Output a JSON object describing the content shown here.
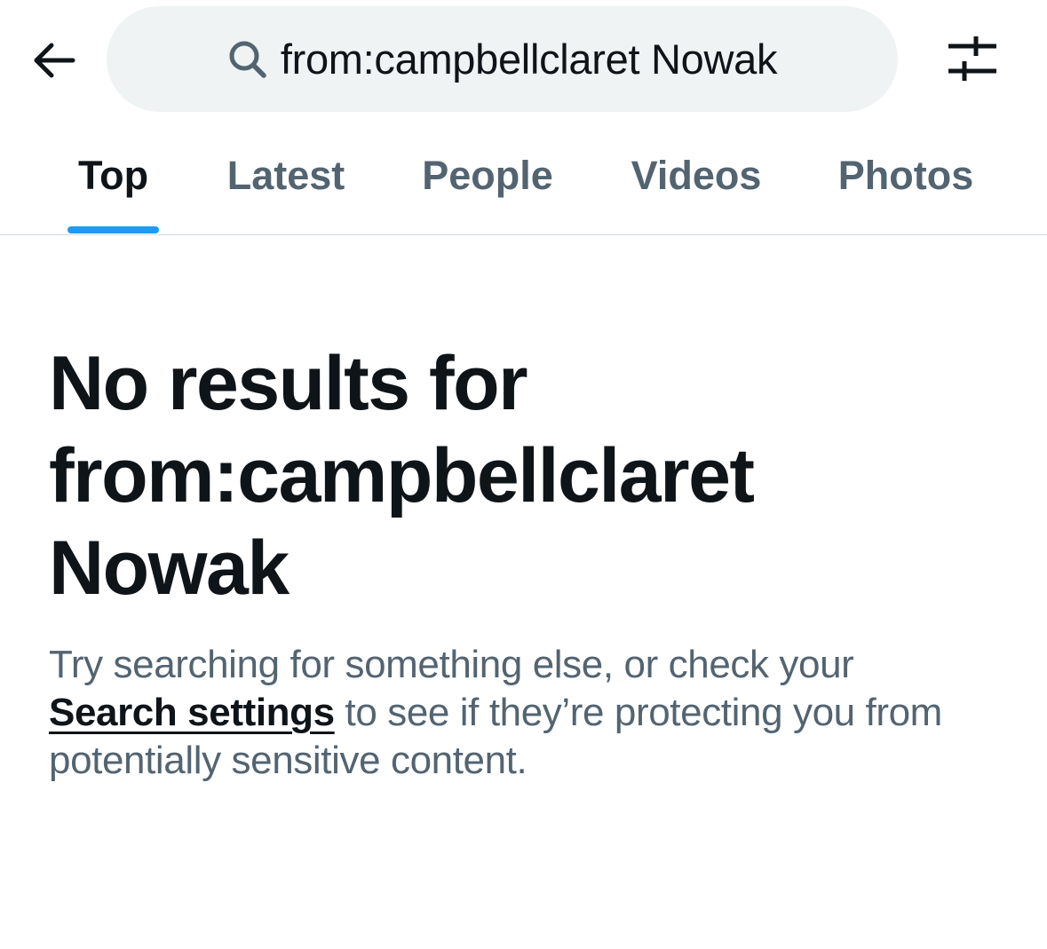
{
  "header": {
    "back_icon": "arrow-left-icon",
    "search": {
      "icon": "search-icon",
      "query": "from:campbellclaret Nowak"
    },
    "filter_icon": "sliders-icon"
  },
  "tabs": [
    {
      "label": "Top",
      "active": true
    },
    {
      "label": "Latest",
      "active": false
    },
    {
      "label": "People",
      "active": false
    },
    {
      "label": "Videos",
      "active": false
    },
    {
      "label": "Photos",
      "active": false
    }
  ],
  "empty_state": {
    "title_line1": "No results for",
    "title_line2": "from:campbellclaret",
    "title_line3": "Nowak",
    "body_before": "Try searching for something else, or check your ",
    "link_label": "Search settings",
    "body_after": " to see if they’re protecting you from potentially sensitive content."
  },
  "colors": {
    "accent": "#1d9bf0",
    "primary_text": "#0f1419",
    "secondary_text": "#536471",
    "search_bg": "#eff3f4",
    "divider": "#cfd9de"
  }
}
